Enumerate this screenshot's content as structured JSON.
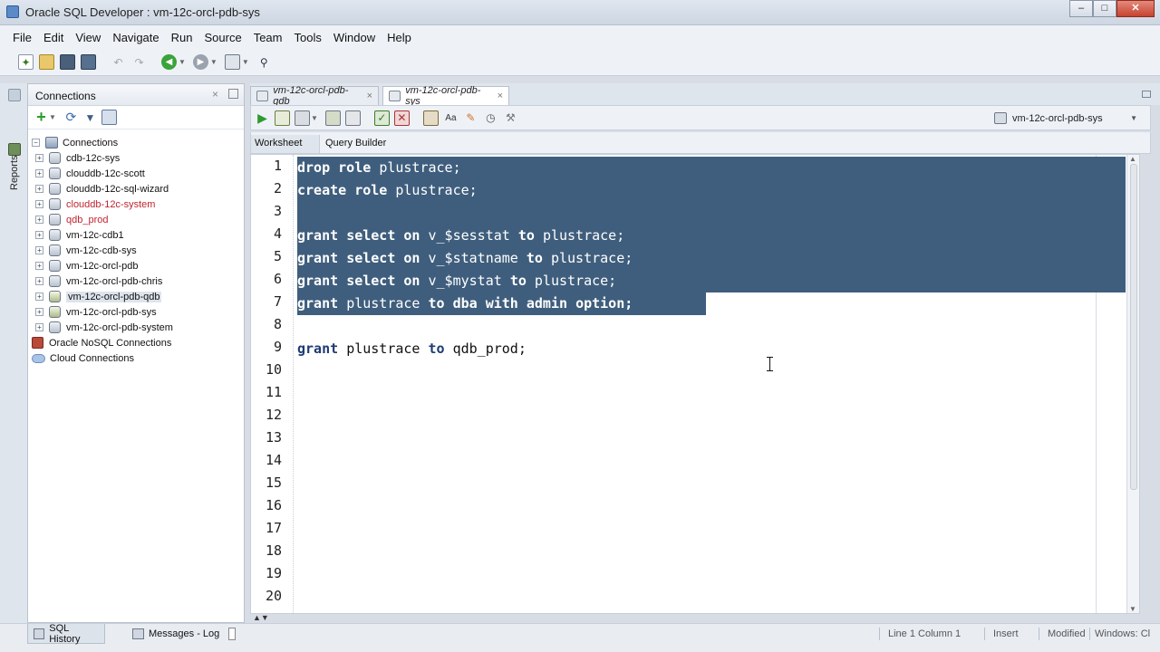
{
  "window": {
    "title": "Oracle SQL Developer : vm-12c-orcl-pdb-sys",
    "controls": [
      "–",
      "□",
      "✕"
    ]
  },
  "menu": [
    "File",
    "Edit",
    "View",
    "Navigate",
    "Run",
    "Source",
    "Team",
    "Tools",
    "Window",
    "Help"
  ],
  "left_strip": {
    "label": "Reports"
  },
  "connections_panel": {
    "title": "Connections",
    "close": "×",
    "tree": [
      {
        "label": "Connections",
        "type": "root-folder",
        "color": "normal"
      },
      {
        "label": "cdb-12c-sys",
        "type": "db",
        "color": "normal"
      },
      {
        "label": "clouddb-12c-scott",
        "type": "db",
        "color": "normal"
      },
      {
        "label": "clouddb-12c-sql-wizard",
        "type": "db",
        "color": "normal"
      },
      {
        "label": "clouddb-12c-system",
        "type": "db",
        "color": "red"
      },
      {
        "label": "qdb_prod",
        "type": "db",
        "color": "red"
      },
      {
        "label": "vm-12c-cdb1",
        "type": "db",
        "color": "normal"
      },
      {
        "label": "vm-12c-cdb-sys",
        "type": "db",
        "color": "normal"
      },
      {
        "label": "vm-12c-orcl-pdb",
        "type": "db",
        "color": "normal"
      },
      {
        "label": "vm-12c-orcl-pdb-chris",
        "type": "db",
        "color": "normal"
      },
      {
        "label": "vm-12c-orcl-pdb-qdb",
        "type": "db-active",
        "color": "selected"
      },
      {
        "label": "vm-12c-orcl-pdb-sys",
        "type": "db-active",
        "color": "normal"
      },
      {
        "label": "vm-12c-orcl-pdb-system",
        "type": "db",
        "color": "normal"
      },
      {
        "label": "Oracle NoSQL Connections",
        "type": "nosql",
        "color": "normal"
      },
      {
        "label": "Cloud Connections",
        "type": "cloud",
        "color": "normal"
      }
    ]
  },
  "editor": {
    "tabs": [
      {
        "label": "vm-12c-orcl-pdb-qdb",
        "active": false
      },
      {
        "label": "vm-12c-orcl-pdb-sys",
        "active": true
      }
    ],
    "connection_selector": "vm-12c-orcl-pdb-sys",
    "subtabs": [
      "Worksheet",
      "Query Builder"
    ],
    "line_numbers": [
      "1",
      "2",
      "3",
      "4",
      "5",
      "6",
      "7",
      "8",
      "9",
      "10",
      "11",
      "12",
      "13",
      "14",
      "15",
      "16",
      "17",
      "18",
      "19",
      "20"
    ],
    "lines": [
      "drop role plustrace;",
      "create role plustrace;",
      "",
      "grant select on v_$sesstat to plustrace;",
      "grant select on v_$statname to plustrace;",
      "grant select on v_$mystat to plustrace;",
      "grant plustrace to dba with admin option;",
      "",
      "grant plustrace to qdb_prod;"
    ],
    "selected_lines": 7
  },
  "statusbar": {
    "tabs": [
      "SQL History",
      "Messages - Log"
    ],
    "items": [
      "Line 1 Column 1",
      "Insert",
      "Modified",
      "Windows: Cl"
    ]
  },
  "colors": {
    "selection": "#3f5e7d",
    "red_connection": "#c0242f",
    "background": "#d8dde5"
  }
}
